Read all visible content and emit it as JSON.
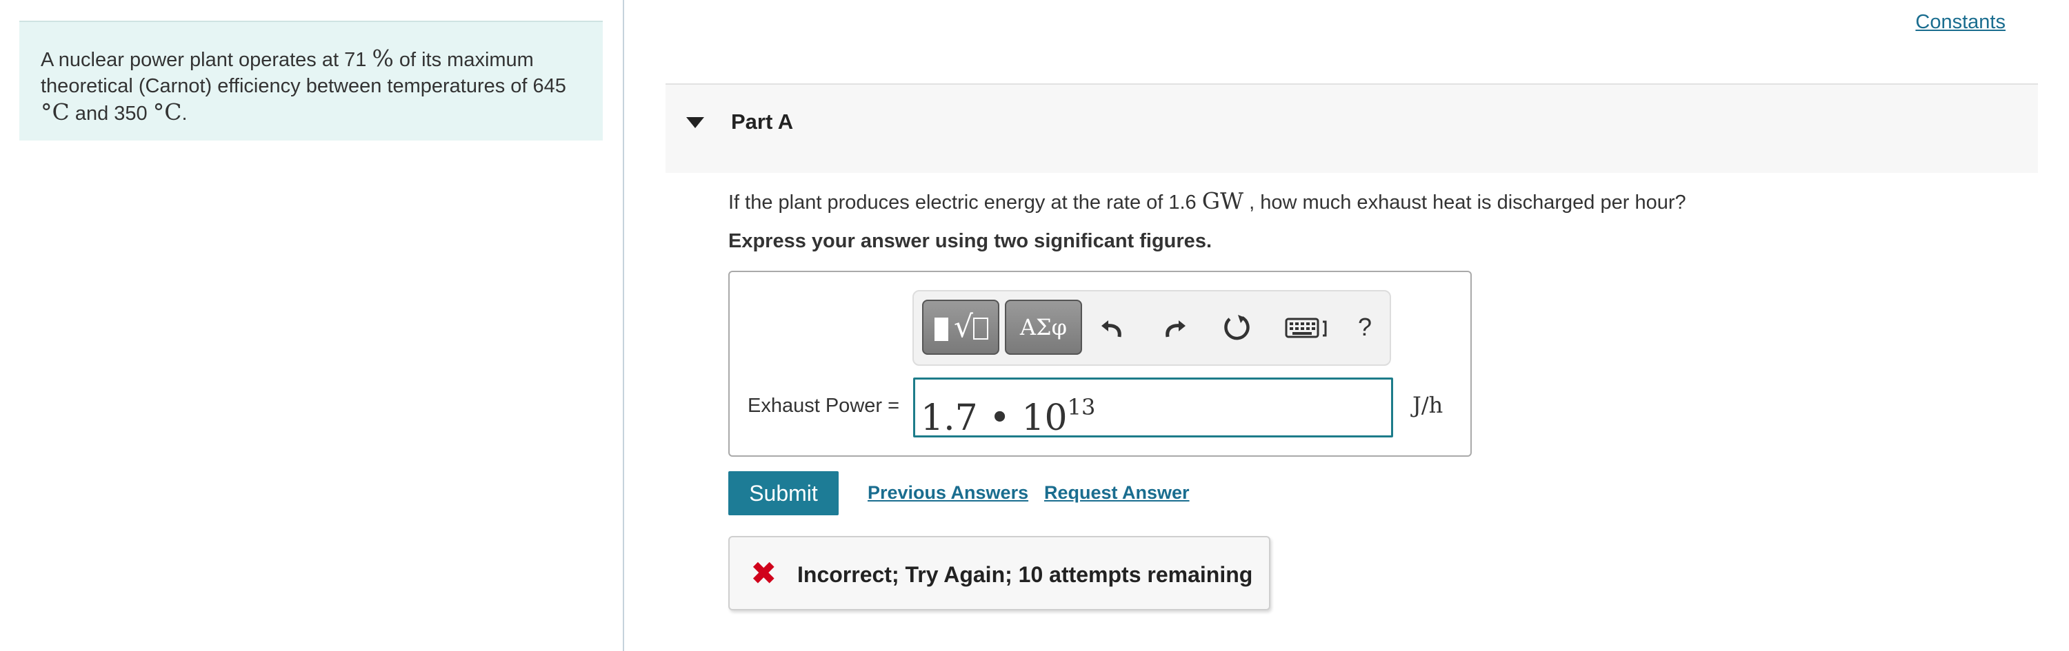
{
  "problem": {
    "text_part1": "A nuclear power plant operates at 71",
    "percent_symbol": "%",
    "text_part2": "of its maximum theoretical (Carnot) efficiency between temperatures of 645",
    "unit_degC_1": "°C",
    "text_part3": "and 350",
    "unit_degC_2": "°C",
    "text_end": "."
  },
  "header": {
    "constants_link": "Constants"
  },
  "part": {
    "title": "Part A"
  },
  "question": {
    "text_before": "If the plant produces electric energy at the rate of 1.6",
    "unit": "GW",
    "text_after": ", how much exhaust heat is discharged per hour?",
    "instruction": "Express your answer using two significant figures."
  },
  "toolbar": {
    "greek_label": "ΑΣφ",
    "help_label": "?",
    "icons": [
      "templates-icon",
      "greek-letters-icon",
      "undo-icon",
      "redo-icon",
      "reset-icon",
      "keyboard-icon",
      "help-icon"
    ]
  },
  "answer": {
    "label": "Exhaust Power =",
    "mantissa": "1.7 • 10",
    "exponent": "13",
    "unit": "J/h"
  },
  "actions": {
    "submit_label": "Submit",
    "previous_answers_label": "Previous Answers",
    "request_answer_label": "Request Answer"
  },
  "feedback": {
    "icon": "x-icon",
    "message": "Incorrect; Try Again; 10 attempts remaining"
  },
  "colors": {
    "problem_bg": "#e6f5f4",
    "accent": "#1d7c96",
    "link": "#1a6d8f",
    "error": "#d0021b",
    "input_border": "#1d7c8a"
  }
}
